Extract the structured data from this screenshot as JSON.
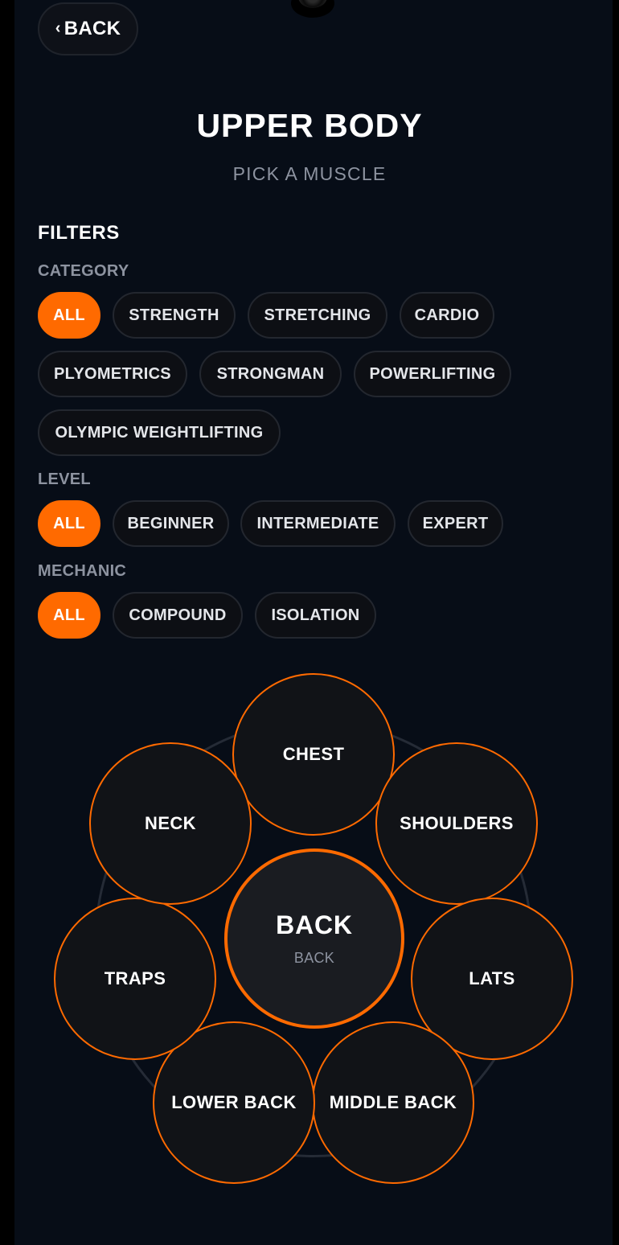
{
  "nav": {
    "back_chevron": "‹",
    "back_label": "BACK"
  },
  "header": {
    "title": "UPPER BODY",
    "subtitle": "PICK A MUSCLE"
  },
  "filters": {
    "heading": "FILTERS",
    "category": {
      "label": "CATEGORY",
      "selected": "ALL",
      "options": [
        "ALL",
        "STRENGTH",
        "STRETCHING",
        "CARDIO",
        "PLYOMETRICS",
        "STRONGMAN",
        "POWERLIFTING",
        "OLYMPIC WEIGHTLIFTING"
      ]
    },
    "level": {
      "label": "LEVEL",
      "selected": "ALL",
      "options": [
        "ALL",
        "BEGINNER",
        "INTERMEDIATE",
        "EXPERT"
      ]
    },
    "mechanic": {
      "label": "MECHANIC",
      "selected": "ALL",
      "options": [
        "ALL",
        "COMPOUND",
        "ISOLATION"
      ]
    }
  },
  "muscle_picker": {
    "center": {
      "title": "BACK",
      "subtitle": "BACK"
    },
    "muscles": [
      "CHEST",
      "SHOULDERS",
      "LATS",
      "MIDDLE BACK",
      "LOWER BACK",
      "TRAPS",
      "NECK"
    ]
  },
  "colors": {
    "accent": "#ff6a00",
    "background": "#070d17",
    "chip_background": "#0d0f14",
    "muted_text": "#8d93a0"
  }
}
